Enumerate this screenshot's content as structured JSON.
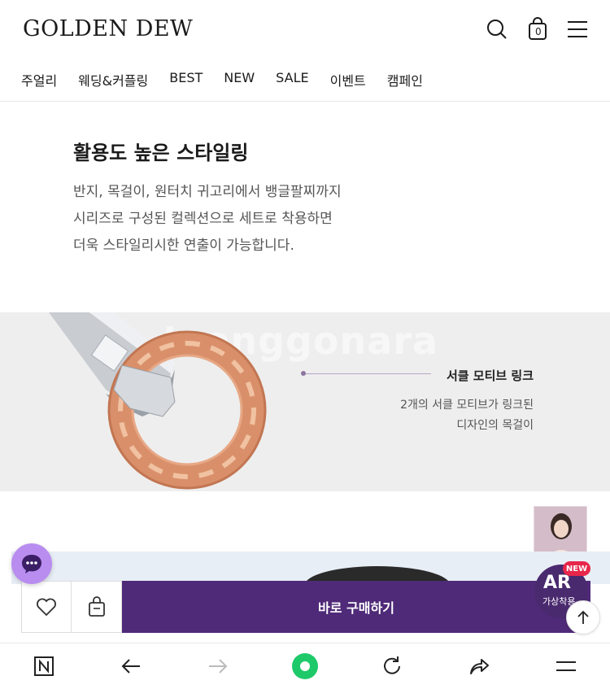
{
  "header": {
    "logo": "GOLDEN DEW",
    "icons": [
      "search-icon",
      "shopping-bag-icon",
      "menu-icon"
    ],
    "cart_count": "0"
  },
  "nav": {
    "items": [
      "주얼리",
      "웨딩&커플링",
      "BEST",
      "NEW",
      "SALE",
      "이벤트",
      "캠페인"
    ]
  },
  "section": {
    "title": "활용도 높은 스타일링",
    "desc": [
      "반지, 목걸이, 원터치 귀고리에서 뱅글팔찌까지",
      "시리즈로 구성된 컬렉션으로 세트로 착용하면",
      "더욱 스타일리시한 연출이 가능합니다."
    ]
  },
  "motif": {
    "title": "서클 모티브 링크",
    "desc": [
      "2개의 서클 모티브가 링크된",
      "디자인의 목걸이"
    ],
    "watermark": "Joonggonara"
  },
  "buy": {
    "main_label": "바로 구매하기",
    "icons": [
      "heart-icon",
      "cart-icon"
    ]
  },
  "ar": {
    "badge": "NEW",
    "title": "AR",
    "subtitle": "가상착용"
  },
  "colors": {
    "brand_purple": "#4f2a78",
    "chat": "#b98df0",
    "new_badge": "#e8264a",
    "rose_gold": "#d9906a",
    "browser_green": "#1ec96a"
  },
  "browser": {
    "icons": [
      "naver-n-icon",
      "back-arrow-icon",
      "forward-arrow-icon",
      "home-green-icon",
      "refresh-icon",
      "share-icon",
      "menu-icon"
    ]
  }
}
